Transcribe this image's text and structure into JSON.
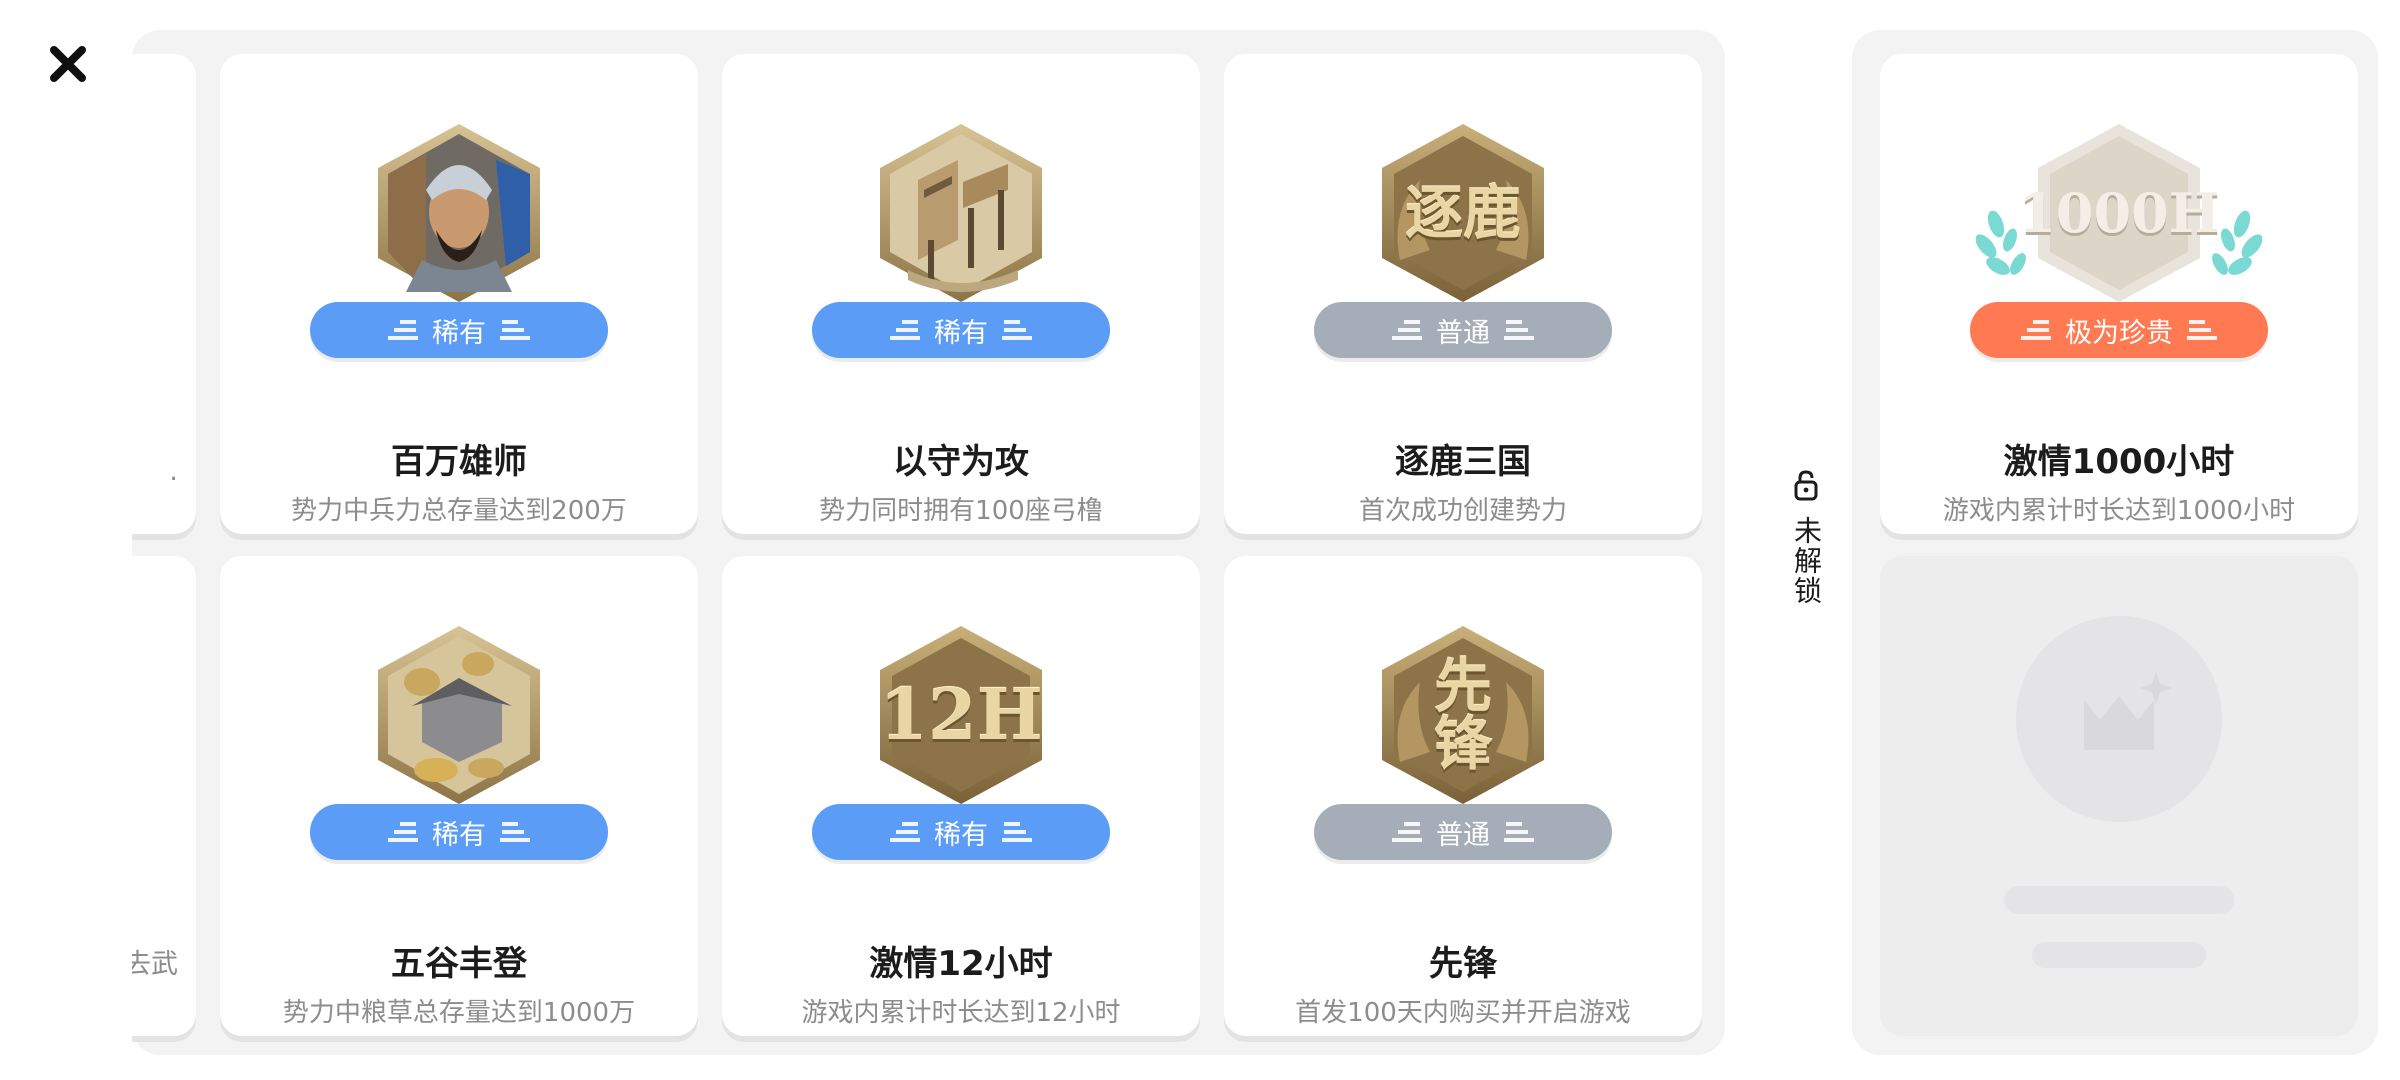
{
  "colors": {
    "rare": "#5b9cf7",
    "common": "#a4adb8",
    "precious": "#ff7a52"
  },
  "left_partial": {
    "top_desc": ".",
    "bottom_desc": "去武"
  },
  "achievements": [
    {
      "icon": "general-portrait-icon",
      "rarity": "稀有",
      "rarity_kind": "rare",
      "title": "百万雄师",
      "desc": "势力中兵力总存量达到200万"
    },
    {
      "icon": "watchtower-icon",
      "rarity": "稀有",
      "rarity_kind": "rare",
      "title": "以守为攻",
      "desc": "势力同时拥有100座弓橹"
    },
    {
      "icon": "deer-chase-glyph-icon",
      "glyph": "逐鹿",
      "rarity": "普通",
      "rarity_kind": "common",
      "title": "逐鹿三国",
      "desc": "首次成功创建势力"
    },
    {
      "icon": "granary-icon",
      "rarity": "稀有",
      "rarity_kind": "rare",
      "title": "五谷丰登",
      "desc": "势力中粮草总存量达到1000万"
    },
    {
      "icon": "twelve-hours-icon",
      "glyph": "12H",
      "rarity": "稀有",
      "rarity_kind": "rare",
      "title": "激情12小时",
      "desc": "游戏内累计时长达到12小时"
    },
    {
      "icon": "vanguard-glyph-icon",
      "glyph": "先锋",
      "rarity": "普通",
      "rarity_kind": "common",
      "title": "先锋",
      "desc": "首发100天内购买并开启游戏"
    }
  ],
  "locked_section": {
    "label": "未解锁",
    "icon": "lock-icon",
    "card": {
      "icon": "thousand-hours-icon",
      "glyph": "1000H",
      "rarity": "极为珍贵",
      "rarity_kind": "precious",
      "title": "激情1000小时",
      "desc": "游戏内累计时长达到1000小时"
    },
    "placeholder_icon": "crown-sparkle-icon"
  }
}
